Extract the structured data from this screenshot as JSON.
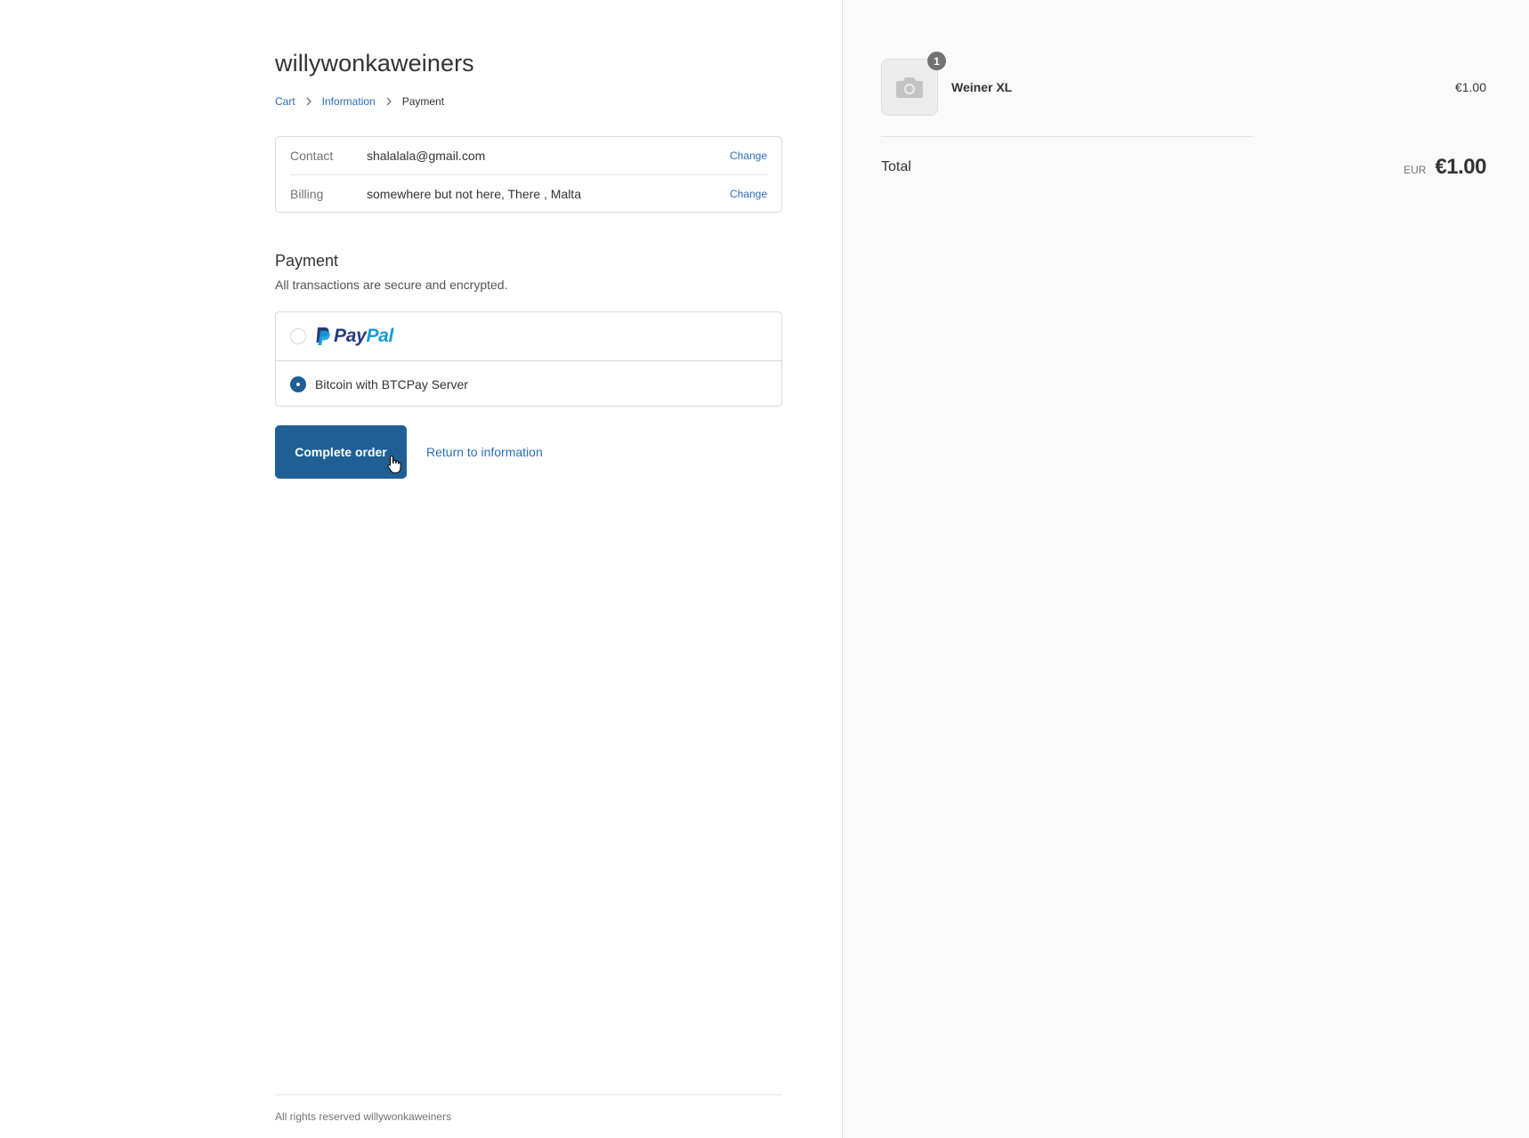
{
  "shop": {
    "title": "willywonkaweiners"
  },
  "breadcrumb": {
    "items": [
      "Cart",
      "Information",
      "Payment"
    ]
  },
  "review": {
    "rows": [
      {
        "label": "Contact",
        "value": "shalalala@gmail.com",
        "action": "Change"
      },
      {
        "label": "Billing",
        "value": "somewhere but not here, There , Malta",
        "action": "Change"
      }
    ]
  },
  "payment": {
    "title": "Payment",
    "subtitle": "All transactions are secure and encrypted.",
    "methods": [
      {
        "name": "PayPal",
        "logo_part1": "Pay",
        "logo_part2": "Pal",
        "selected": false
      },
      {
        "name": "Bitcoin with BTCPay Server",
        "selected": true
      }
    ]
  },
  "actions": {
    "complete_label": "Complete order",
    "return_label": "Return to information"
  },
  "footer": {
    "text": "All rights reserved willywonkaweiners"
  },
  "summary": {
    "product": {
      "name": "Weiner XL",
      "price": "€1.00",
      "quantity": "1",
      "thumbnail_icon": "camera-icon"
    },
    "total_label": "Total",
    "currency": "EUR",
    "total_value": "€1.00"
  },
  "colors": {
    "accent": "#1f5f94",
    "link": "#2a6ebb",
    "paypal_dark": "#253b80",
    "paypal_light": "#179bd7"
  }
}
